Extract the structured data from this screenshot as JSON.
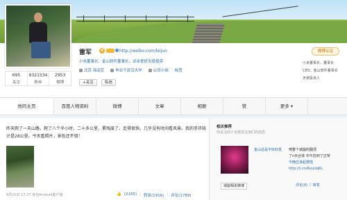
{
  "profile": {
    "name": "雷军",
    "url": "http://weibo.com/leijun",
    "description": "小米董事长，金山软件董事长，业余爱好天使投资",
    "location": "北京 海淀区",
    "school": "毕业于武汉大学",
    "company": "公司小米",
    "tags_label": "标签",
    "follow_button": "+关注",
    "message_button": "私信",
    "certify_button": "微博认证",
    "right_desc_line1": "小米董事长，董事长",
    "right_desc_line2": "CEO，金山软件董事长",
    "right_desc_line3": "天使投资人"
  },
  "stats": [
    {
      "num": "695",
      "label": "关注"
    },
    {
      "num": "9321534",
      "label": "粉丝"
    },
    {
      "num": "2953",
      "label": "微博"
    }
  ],
  "tabs": [
    {
      "label": "他的主页"
    },
    {
      "label": "百度人物资料"
    },
    {
      "label": "微博"
    },
    {
      "label": "文章"
    },
    {
      "label": "相册"
    },
    {
      "label": "赞"
    },
    {
      "label": "更多 ▾"
    }
  ],
  "post": {
    "text": "昨天爬了一天山路，爬了八个半小时，二十多公里，累残废了，走得很快。几乎没有时间看风景。我的手环统计是28公里。今天看照片，景色还不错！",
    "meta": "6月20日 17:37  来自Android客户端",
    "likes": "(2165)",
    "repost": "转发(1916)",
    "comment": "评论(1789)"
  },
  "side": {
    "heading": "相关推荐",
    "sub": "你关注的人也很关注他们的动态",
    "user": "金山总是不好好发",
    "text_a": "喷香个城崩的翻顶",
    "text_b": "了n天合体 中午抗到了正常",
    "text_c": "今晚应该起楼啦 http://t.cn/RvuUqRL",
    "tag": "城崩相关微博",
    "actions_comment": "评论(8)",
    "actions_repost": "转发"
  }
}
